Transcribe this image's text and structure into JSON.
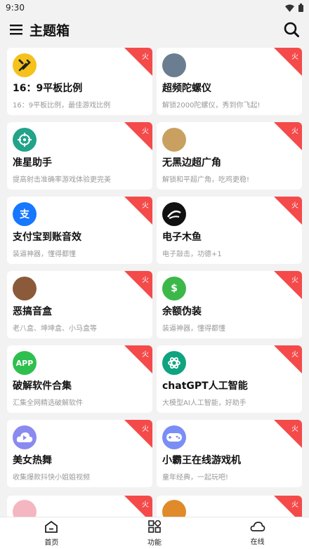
{
  "status_bar": {
    "time": "9:30"
  },
  "header": {
    "title": "主题箱",
    "menu_icon": "menu-icon",
    "search_icon": "search-icon"
  },
  "badge_label": "火",
  "cards": [
    {
      "title": "16：9平板比例",
      "subtitle": "16：9平板比例，最佳游戏比例",
      "icon": "tools-icon",
      "icon_bg": "#f5c21b",
      "icon_text": ""
    },
    {
      "title": "超频陀螺仪",
      "subtitle": "解锁2000陀螺仪，秀到你飞起!",
      "icon": "game-avatar-icon",
      "icon_bg": "#6b7d91",
      "icon_text": ""
    },
    {
      "title": "准星助手",
      "subtitle": "提高射击准确率游戏体验更完美",
      "icon": "crosshair-icon",
      "icon_bg": "#22a38a",
      "icon_text": ""
    },
    {
      "title": "无黑边超广角",
      "subtitle": "解锁和平超广角，吃鸡更稳!",
      "icon": "helmet-avatar-icon",
      "icon_bg": "#c9a060",
      "icon_text": ""
    },
    {
      "title": "支付宝到账音效",
      "subtitle": "装逼神器，懂得都懂",
      "icon": "alipay-icon",
      "icon_bg": "#1677ff",
      "icon_text": "支"
    },
    {
      "title": "电子木鱼",
      "subtitle": "电子敲击，功德+1",
      "icon": "wooden-fish-icon",
      "icon_bg": "#111111",
      "icon_text": ""
    },
    {
      "title": "恶搞音盒",
      "subtitle": "老八盒、坤坤盒、小马盒等",
      "icon": "face-avatar-icon",
      "icon_bg": "#8a5a3a",
      "icon_text": ""
    },
    {
      "title": "余额伪装",
      "subtitle": "装逼神器，懂得都懂",
      "icon": "money-bag-icon",
      "icon_bg": "#3cb84a",
      "icon_text": "$"
    },
    {
      "title": "破解软件合集",
      "subtitle": "汇集全网精选破解软件",
      "icon": "app-icon",
      "icon_bg": "#2fbf4f",
      "icon_text": "APP"
    },
    {
      "title": "chatGPT人工智能",
      "subtitle": "大模型AI人工智能，好助手",
      "icon": "chatgpt-icon",
      "icon_bg": "#10a37f",
      "icon_text": ""
    },
    {
      "title": "美女热舞",
      "subtitle": "收集爆款抖快小姐姐视频",
      "icon": "play-cloud-icon",
      "icon_bg": "#8a8af0",
      "icon_text": ""
    },
    {
      "title": "小霸王在线游戏机",
      "subtitle": "童年经典，一起玩吧!",
      "icon": "gamepad-icon",
      "icon_bg": "#7a8ef5",
      "icon_text": ""
    }
  ],
  "partial_cards": [
    {
      "icon": "girl-avatar-icon",
      "icon_bg": "#f4b6c0"
    },
    {
      "icon": "hero-avatar-icon",
      "icon_bg": "#e08a2a"
    }
  ],
  "bottom_nav": [
    {
      "label": "首页",
      "icon": "home-icon"
    },
    {
      "label": "功能",
      "icon": "grid-icon"
    },
    {
      "label": "在线",
      "icon": "cloud-icon"
    }
  ]
}
